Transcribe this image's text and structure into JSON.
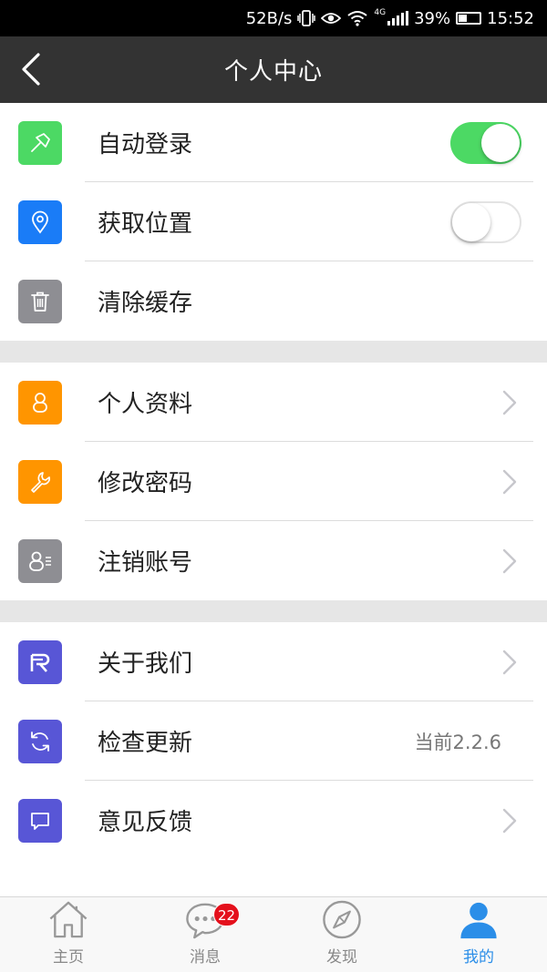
{
  "status_bar": {
    "net_speed": "52B/s",
    "network_type": "4G",
    "battery_percent": "39%",
    "time": "15:52"
  },
  "header": {
    "title": "个人中心",
    "back_icon": "chevron-left-icon"
  },
  "groups": [
    {
      "items": [
        {
          "label": "自动登录",
          "icon": "pin-icon",
          "icon_color": "#4cd964",
          "control": "toggle",
          "toggle_on": true
        },
        {
          "label": "获取位置",
          "icon": "location-pin-icon",
          "icon_color": "#1a7cf7",
          "control": "toggle",
          "toggle_on": false
        },
        {
          "label": "清除缓存",
          "icon": "trash-icon",
          "icon_color": "#8e8e93",
          "control": "none"
        }
      ]
    },
    {
      "items": [
        {
          "label": "个人资料",
          "icon": "person-icon",
          "icon_color": "#ff9500",
          "control": "chevron"
        },
        {
          "label": "修改密码",
          "icon": "wrench-icon",
          "icon_color": "#ff9500",
          "control": "chevron"
        },
        {
          "label": "注销账号",
          "icon": "user-list-icon",
          "icon_color": "#8e8e93",
          "control": "chevron"
        }
      ]
    },
    {
      "items": [
        {
          "label": "关于我们",
          "icon": "logo-r-icon",
          "icon_color": "#5856d6",
          "control": "chevron"
        },
        {
          "label": "检查更新",
          "icon": "refresh-icon",
          "icon_color": "#5856d6",
          "control": "value",
          "value": "当前2.2.6"
        },
        {
          "label": "意见反馈",
          "icon": "chat-bubble-icon",
          "icon_color": "#5856d6",
          "control": "chevron"
        }
      ]
    }
  ],
  "tabbar": {
    "tabs": [
      {
        "label": "主页",
        "icon": "home-icon",
        "active": false
      },
      {
        "label": "消息",
        "icon": "message-icon",
        "active": false,
        "badge": "22"
      },
      {
        "label": "发现",
        "icon": "compass-icon",
        "active": false
      },
      {
        "label": "我的",
        "icon": "user-icon",
        "active": true
      }
    ],
    "active_color": "#2b8ee8"
  }
}
